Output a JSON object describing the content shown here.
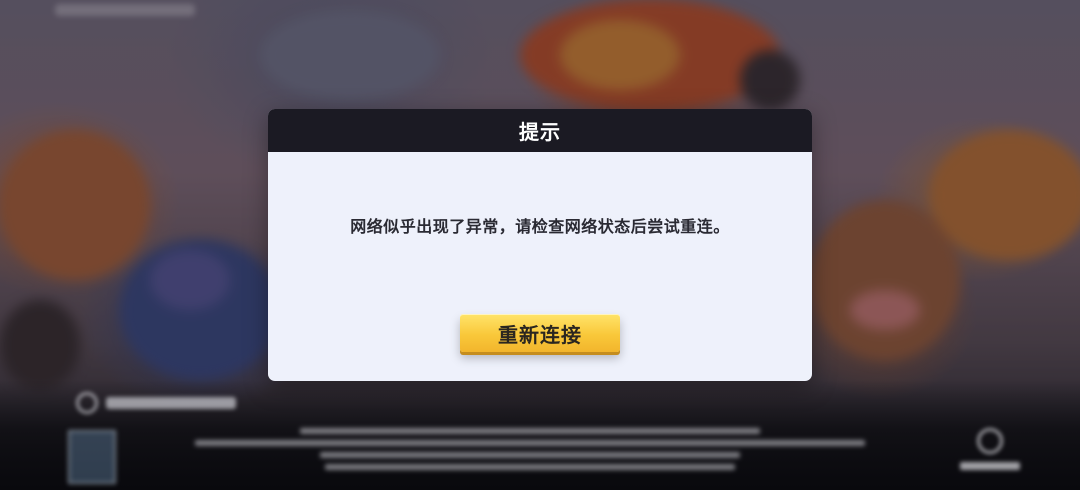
{
  "dialog": {
    "title": "提示",
    "message": "网络似乎出现了异常，请检查网络状态后尝试重连。",
    "reconnect_label": "重新连接"
  },
  "colors": {
    "header_bg": "#1b1a23",
    "dialog_bg": "#eef1fb",
    "button_yellow": "#f9c83a",
    "text_dark": "#2a2a33"
  }
}
